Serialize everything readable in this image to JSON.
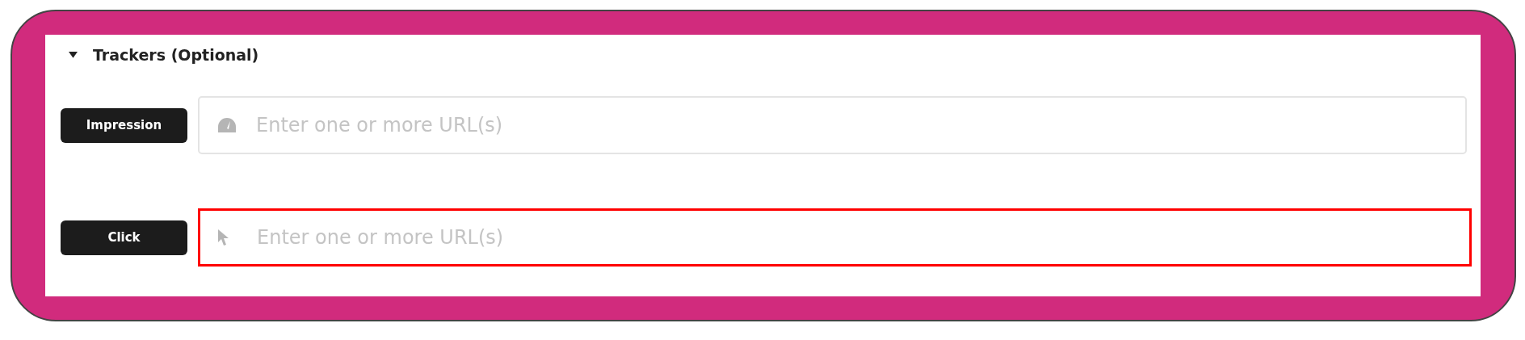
{
  "section": {
    "title": "Trackers (Optional)",
    "expanded": true
  },
  "trackers": [
    {
      "label": "Impression",
      "placeholder": "Enter one or more URL(s)",
      "kind": "gauge",
      "highlighted": false
    },
    {
      "label": "Click",
      "placeholder": "Enter one or more URL(s)",
      "kind": "pointer",
      "highlighted": true
    }
  ]
}
